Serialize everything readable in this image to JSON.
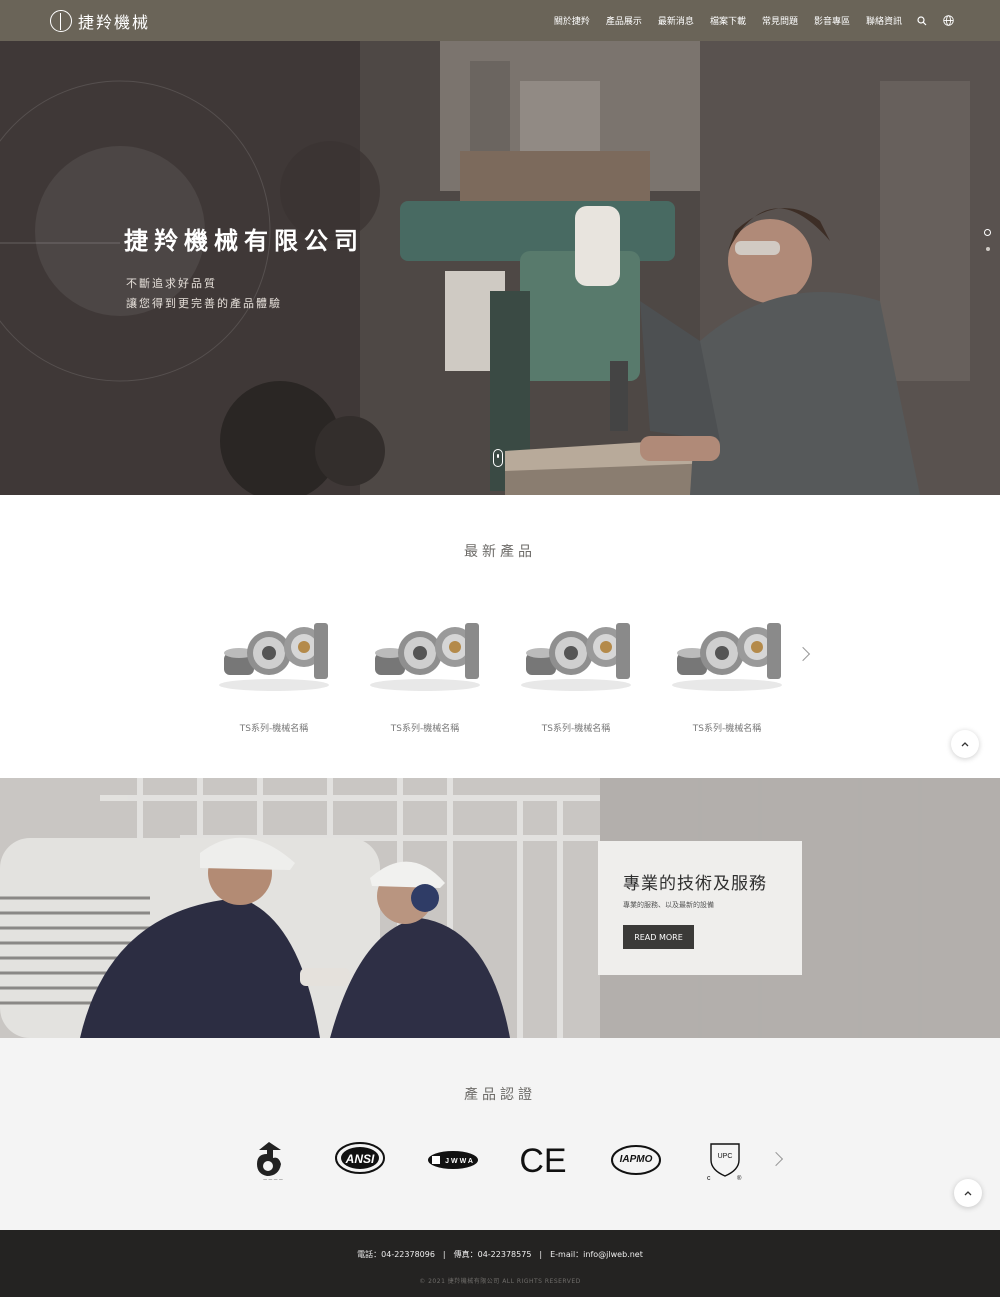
{
  "header": {
    "brand": "捷羚機械",
    "nav": [
      "關於捷羚",
      "產品展示",
      "最新消息",
      "檔案下載",
      "常見問題",
      "影音專區",
      "聯絡資訊"
    ],
    "icons": [
      "search-icon",
      "globe-icon"
    ]
  },
  "hero": {
    "title": "捷羚機械有限公司",
    "subtitle_1": "不斷追求好品質",
    "subtitle_2": "讓您得到更完善的產品體驗"
  },
  "products": {
    "title": "最新產品",
    "items": [
      {
        "name": "TS系列-機械名稱"
      },
      {
        "name": "TS系列-機械名稱"
      },
      {
        "name": "TS系列-機械名稱"
      },
      {
        "name": "TS系列-機械名稱"
      }
    ]
  },
  "service": {
    "title": "專業的技術及服務",
    "desc": "專業的服務、以及最新的設備",
    "button": "READ MORE"
  },
  "certs": {
    "title": "產品認證",
    "items": [
      "ANSI",
      "JWWA",
      "CE",
      "IAPMO",
      "UPC"
    ]
  },
  "footer": {
    "contact": "電話：04-22378096　|　傳真：04-22378575　|　E-mail：info@jlweb.net",
    "copyright": "© 2021 捷羚機械有限公司 ALL RIGHTS RESERVED"
  },
  "colors": {
    "header_bg": "#6a6458",
    "footer_bg": "#242322",
    "button_bg": "#3b3a38"
  }
}
